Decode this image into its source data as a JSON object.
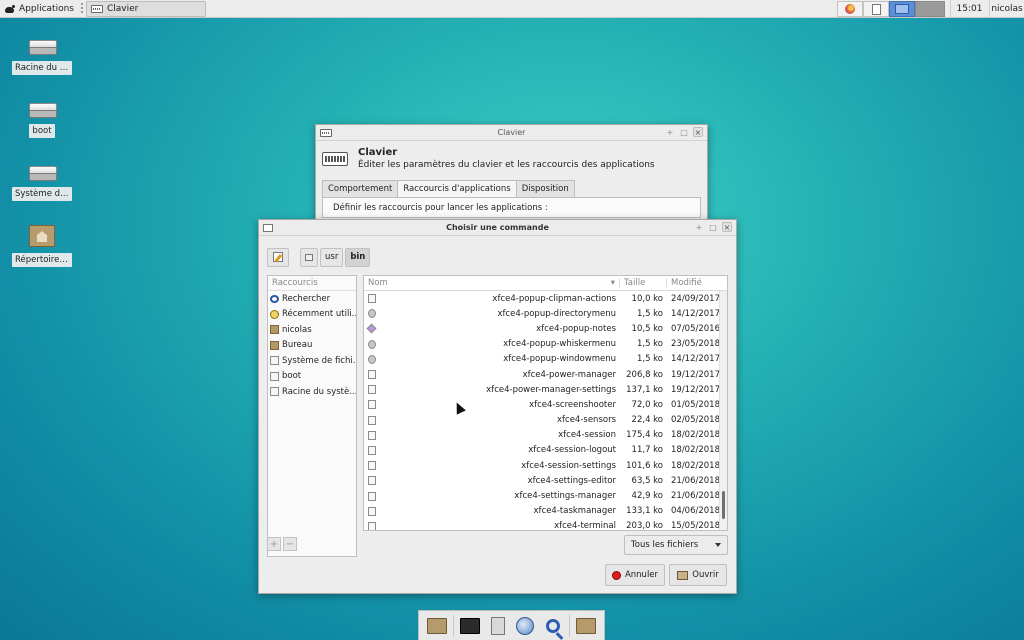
{
  "top_panel": {
    "apps_label": "Applications",
    "task_label": "Clavier",
    "clock": "15:01",
    "user": "nicolas",
    "tray_icons": [
      "firefox-icon",
      "notes-icon",
      "workspace-icon",
      "workspace-2-icon"
    ]
  },
  "desktop": {
    "icons": [
      {
        "label": "Racine du sy...",
        "icon": "drive-icon"
      },
      {
        "label": "boot",
        "icon": "drive-icon"
      },
      {
        "label": "Système de ...",
        "icon": "drive-icon"
      },
      {
        "label": "Répertoire p...",
        "icon": "home-folder-icon"
      }
    ]
  },
  "clavier_window": {
    "title": "Clavier",
    "heading": "Clavier",
    "subtitle": "Éditer les paramètres du clavier et les raccourcis des applications",
    "tabs": [
      "Comportement",
      "Raccourcis d'applications",
      "Disposition"
    ],
    "active_tab": 1,
    "body_text": "Définir les raccourcis pour lancer les applications :"
  },
  "chooser": {
    "title": "Choisir une commande",
    "path": [
      "usr",
      "bin"
    ],
    "places_header": "Raccourcis",
    "places": [
      {
        "label": "Rechercher",
        "icon": "search"
      },
      {
        "label": "Récemment utili...",
        "icon": "recent"
      },
      {
        "label": "nicolas",
        "icon": "folder"
      },
      {
        "label": "Bureau",
        "icon": "folder"
      },
      {
        "label": "Système de fichi...",
        "icon": "disk"
      },
      {
        "label": "boot",
        "icon": "disk"
      },
      {
        "label": "Racine du systè...",
        "icon": "disk"
      }
    ],
    "columns": {
      "name": "Nom",
      "size": "Taille",
      "modified": "Modifié"
    },
    "files": [
      {
        "name": "xfce4-popup-clipman-actions",
        "size": "10,0 ko",
        "modified": "24/09/2017",
        "icon": "file"
      },
      {
        "name": "xfce4-popup-directorymenu",
        "size": "1,5 ko",
        "modified": "14/12/2017",
        "icon": "gear"
      },
      {
        "name": "xfce4-popup-notes",
        "size": "10,5 ko",
        "modified": "07/05/2016",
        "icon": "notes"
      },
      {
        "name": "xfce4-popup-whiskermenu",
        "size": "1,5 ko",
        "modified": "23/05/2018",
        "icon": "gear"
      },
      {
        "name": "xfce4-popup-windowmenu",
        "size": "1,5 ko",
        "modified": "14/12/2017",
        "icon": "gear"
      },
      {
        "name": "xfce4-power-manager",
        "size": "206,8 ko",
        "modified": "19/12/2017",
        "icon": "file"
      },
      {
        "name": "xfce4-power-manager-settings",
        "size": "137,1 ko",
        "modified": "19/12/2017",
        "icon": "file"
      },
      {
        "name": "xfce4-screenshooter",
        "size": "72,0 ko",
        "modified": "01/05/2018",
        "icon": "file"
      },
      {
        "name": "xfce4-sensors",
        "size": "22,4 ko",
        "modified": "02/05/2018",
        "icon": "file"
      },
      {
        "name": "xfce4-session",
        "size": "175,4 ko",
        "modified": "18/02/2018",
        "icon": "file"
      },
      {
        "name": "xfce4-session-logout",
        "size": "11,7 ko",
        "modified": "18/02/2018",
        "icon": "file"
      },
      {
        "name": "xfce4-session-settings",
        "size": "101,6 ko",
        "modified": "18/02/2018",
        "icon": "file"
      },
      {
        "name": "xfce4-settings-editor",
        "size": "63,5 ko",
        "modified": "21/06/2018",
        "icon": "file"
      },
      {
        "name": "xfce4-settings-manager",
        "size": "42,9 ko",
        "modified": "21/06/2018",
        "icon": "file"
      },
      {
        "name": "xfce4-taskmanager",
        "size": "133,1 ko",
        "modified": "04/06/2018",
        "icon": "file"
      },
      {
        "name": "xfce4-terminal",
        "size": "203,0 ko",
        "modified": "15/05/2018",
        "icon": "file"
      }
    ],
    "filter": "Tous les fichiers",
    "cancel_label": "Annuler",
    "open_label": "Ouvrir"
  },
  "dock": {
    "items": [
      "home-folder-icon",
      "terminal-icon",
      "file-manager-icon",
      "web-browser-icon",
      "search-icon",
      "folder-icon"
    ]
  }
}
